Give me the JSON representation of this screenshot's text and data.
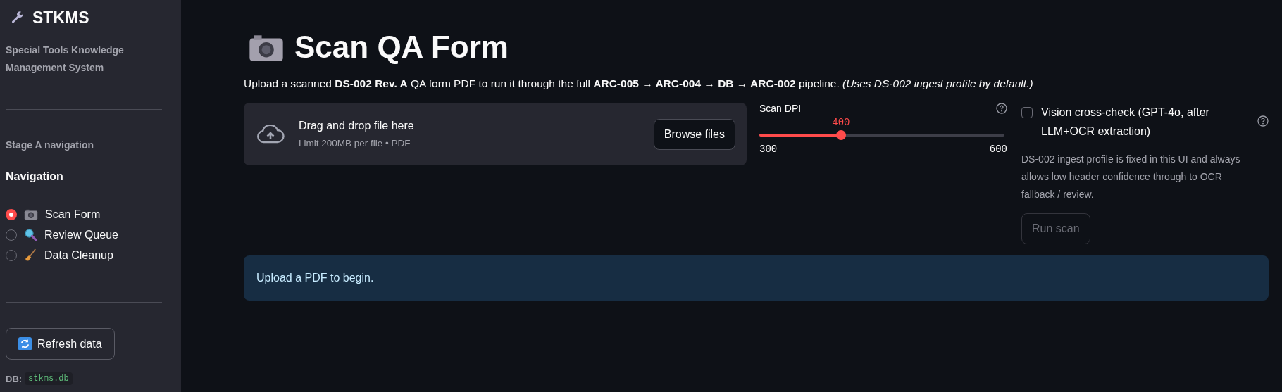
{
  "sidebar": {
    "app_title": "STKMS",
    "subtitle": "Special Tools Knowledge Management System",
    "section_caption": "Stage A navigation",
    "nav_heading": "Navigation",
    "nav_items": [
      {
        "label": "Scan Form",
        "kind": "camera",
        "selected": true
      },
      {
        "label": "Review Queue",
        "kind": "magnifier",
        "selected": false
      },
      {
        "label": "Data Cleanup",
        "kind": "broom",
        "selected": false
      }
    ],
    "refresh_button": "Refresh data",
    "db_label": "DB:",
    "db_name": "stkms.db"
  },
  "main": {
    "title": "Scan QA Form",
    "description": "Upload a scanned **DS-002 Rev. A** QA form PDF to run it through the full **ARC-005 → ARC-004 → DB → ARC-002** pipeline. *(Uses DS-002 ingest profile by default.)*",
    "uploader": {
      "prompt": "Drag and drop file here",
      "limit": "Limit 200MB per file • PDF",
      "button": "Browse files"
    },
    "slider": {
      "label": "Scan DPI",
      "value": "400",
      "min": "300",
      "max": "600",
      "level": 0.333
    },
    "vision_check": {
      "label": "Vision cross-check (GPT-4o, after LLM+OCR extraction)",
      "checked": false
    },
    "profile_note": "DS-002 ingest profile is fixed in this UI and always allows low header confidence through to OCR fallback / review.",
    "run_button": {
      "label": "Run scan",
      "disabled": true
    },
    "info": "Upload a PDF to begin."
  }
}
